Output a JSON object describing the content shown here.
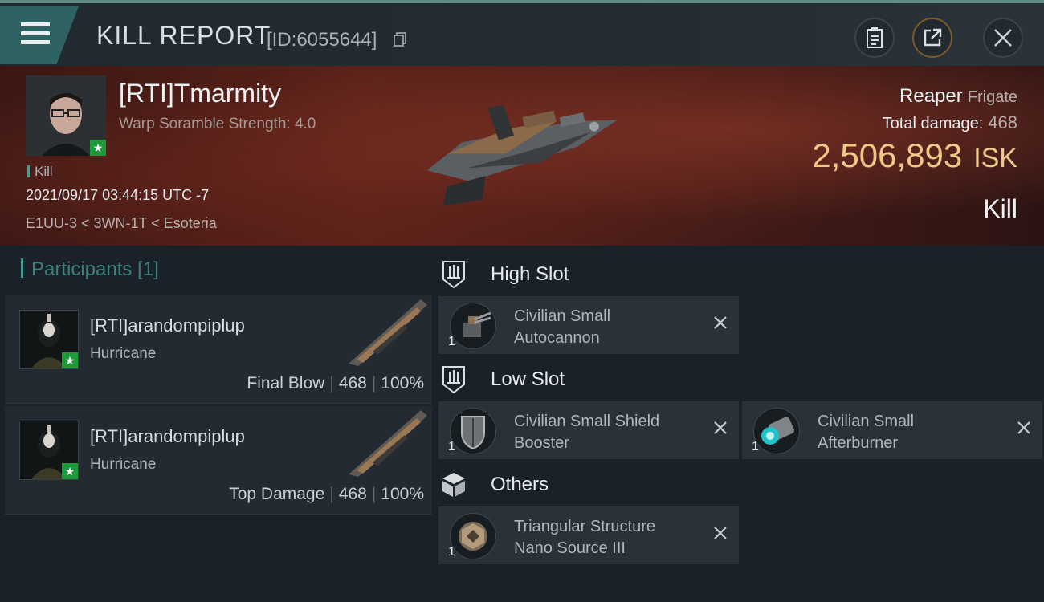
{
  "header": {
    "title": "KILL REPORT",
    "report_id": "[ID:6055644]"
  },
  "victim": {
    "name": "[RTI]Tmarmity",
    "subtitle": "Warp Soramble Strength: 4.0",
    "tag": "Kill",
    "datetime": "2021/09/17 03:44:15 UTC -7",
    "location": "E1UU-3 < 3WN-1T < Esoteria",
    "ship": "Reaper",
    "ship_class": "Frigate",
    "damage_label": "Total damage:",
    "damage_value": "468",
    "isk_value": "2,506,893",
    "isk_unit": "ISK",
    "result": "Kill"
  },
  "participants": {
    "header": "Participants [1]",
    "items": [
      {
        "name": "[RTI]arandompiplup",
        "ship": "Hurricane",
        "role": "Final Blow",
        "damage": "468",
        "percent": "100%"
      },
      {
        "name": "[RTI]arandompiplup",
        "ship": "Hurricane",
        "role": "Top Damage",
        "damage": "468",
        "percent": "100%"
      }
    ]
  },
  "fitting": {
    "high_slot": {
      "label": "High Slot",
      "modules": [
        {
          "name": "Civilian Small\nAutocannon",
          "qty": "1"
        }
      ]
    },
    "low_slot": {
      "label": "Low Slot",
      "modules": [
        {
          "name": "Civilian Small Shield\nBooster",
          "qty": "1"
        },
        {
          "name": "Civilian Small\nAfterburner",
          "qty": "1"
        }
      ]
    },
    "others": {
      "label": "Others",
      "modules": [
        {
          "name": "Triangular Structure\nNano Source III",
          "qty": "1"
        }
      ]
    }
  },
  "colors": {
    "accent_teal": "#2e6263",
    "isk_gold": "#f0c98a",
    "badge_green": "#1f9a3b"
  }
}
